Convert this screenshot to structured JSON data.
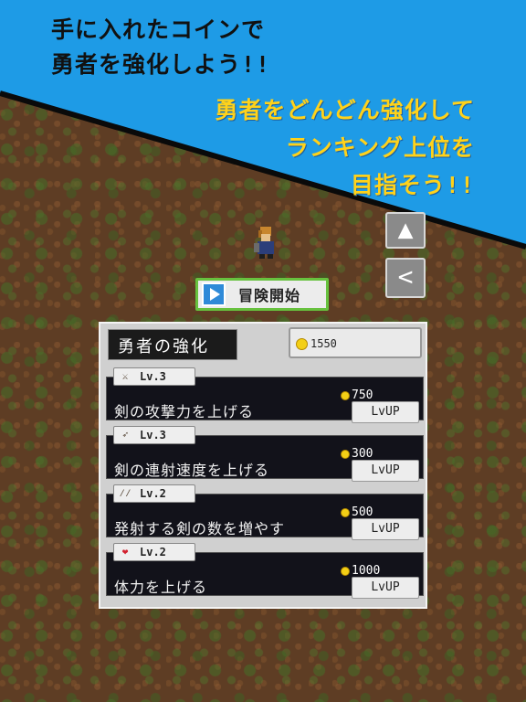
{
  "promo": {
    "line1": [
      "手に入れたコインで",
      "勇者を強化しよう!!"
    ],
    "line2": [
      "勇者をどんどん強化して",
      "ランキング上位を",
      "目指そう!!"
    ]
  },
  "colors": {
    "banner_blue": "#1e9be6",
    "accent_yellow": "#ffd21a",
    "start_border": "#67c13e"
  },
  "side_buttons": [
    {
      "icon": "ranking-icon",
      "glyph": "▲"
    },
    {
      "icon": "share-icon",
      "glyph": "<"
    }
  ],
  "start_button": {
    "label": "冒険開始",
    "icon": "play-icon"
  },
  "upgrade_panel": {
    "title": "勇者の強化",
    "coins": "1550",
    "items": [
      {
        "icon": "sword-icon",
        "glyph": "⚔",
        "level": "Lv.3",
        "description": "剣の攻撃力を上げる",
        "cost": "750",
        "button": "LvUP"
      },
      {
        "icon": "flying-sword-icon",
        "glyph": "➶",
        "level": "Lv.3",
        "description": "剣の連射速度を上げる",
        "cost": "300",
        "button": "LvUP"
      },
      {
        "icon": "multi-sword-icon",
        "glyph": "⁄⁄",
        "level": "Lv.2",
        "description": "発射する剣の数を増やす",
        "cost": "500",
        "button": "LvUP"
      },
      {
        "icon": "heart-icon",
        "glyph": "❤",
        "level": "Lv.2",
        "description": "体力を上げる",
        "cost": "1000",
        "button": "LvUP"
      }
    ]
  }
}
